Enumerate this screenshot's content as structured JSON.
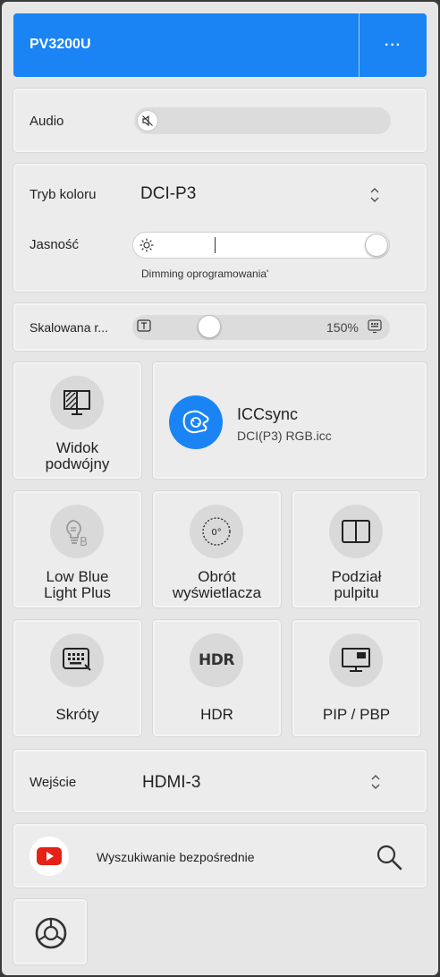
{
  "header": {
    "title": "PV3200U",
    "more_label": "···"
  },
  "audio": {
    "label": "Audio",
    "icon": "speaker-muted-icon"
  },
  "color": {
    "mode_label": "Tryb koloru",
    "mode_value": "DCI-P3",
    "brightness_label": "Jasność",
    "brightness_level": 1.0,
    "dimming_note": "Dimming oprogramowania'"
  },
  "scaling": {
    "label": "Skalowana r...",
    "value": "150%",
    "level": 0.22
  },
  "tiles": {
    "dual_view": "Widok\npodwójny",
    "icc_title": "ICCsync",
    "icc_sub": "DCI(P3) RGB.icc",
    "low_blue": "Low Blue\nLight Plus",
    "rotation": "Obrót\nwyświetlacza",
    "rotation_value": "0°",
    "desktop_split": "Podział\npulpitu",
    "shortcuts": "Skróty",
    "hdr": "HDR",
    "hdr_icon_text": "HDR",
    "pip": "PIP / PBP"
  },
  "input": {
    "label": "Wejście",
    "value": "HDMI-3"
  },
  "search": {
    "label": "Wyszukiwanie bezpośrednie"
  },
  "colors": {
    "accent": "#1a84f4",
    "youtube": "#e62117"
  }
}
